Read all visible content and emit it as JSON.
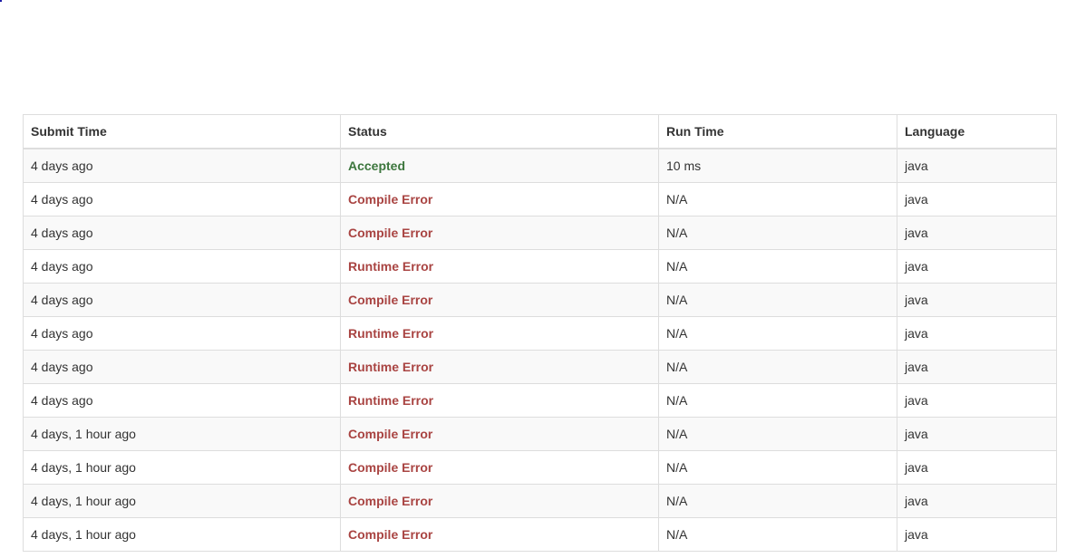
{
  "table": {
    "headers": [
      "Submit Time",
      "Status",
      "Run Time",
      "Language"
    ],
    "rows": [
      {
        "submit_time": "4 days ago",
        "status": "Accepted",
        "run_time": "10 ms",
        "language": "java"
      },
      {
        "submit_time": "4 days ago",
        "status": "Compile Error",
        "run_time": "N/A",
        "language": "java"
      },
      {
        "submit_time": "4 days ago",
        "status": "Compile Error",
        "run_time": "N/A",
        "language": "java"
      },
      {
        "submit_time": "4 days ago",
        "status": "Runtime Error",
        "run_time": "N/A",
        "language": "java"
      },
      {
        "submit_time": "4 days ago",
        "status": "Compile Error",
        "run_time": "N/A",
        "language": "java"
      },
      {
        "submit_time": "4 days ago",
        "status": "Runtime Error",
        "run_time": "N/A",
        "language": "java"
      },
      {
        "submit_time": "4 days ago",
        "status": "Runtime Error",
        "run_time": "N/A",
        "language": "java"
      },
      {
        "submit_time": "4 days ago",
        "status": "Runtime Error",
        "run_time": "N/A",
        "language": "java"
      },
      {
        "submit_time": "4 days, 1 hour ago",
        "status": "Compile Error",
        "run_time": "N/A",
        "language": "java"
      },
      {
        "submit_time": "4 days, 1 hour ago",
        "status": "Compile Error",
        "run_time": "N/A",
        "language": "java"
      },
      {
        "submit_time": "4 days, 1 hour ago",
        "status": "Compile Error",
        "run_time": "N/A",
        "language": "java"
      },
      {
        "submit_time": "4 days, 1 hour ago",
        "status": "Compile Error",
        "run_time": "N/A",
        "language": "java"
      }
    ]
  },
  "colors": {
    "accepted": "#3c763d",
    "error": "#a94442",
    "stripe": "#f9f9f9",
    "border": "#dddddd"
  }
}
